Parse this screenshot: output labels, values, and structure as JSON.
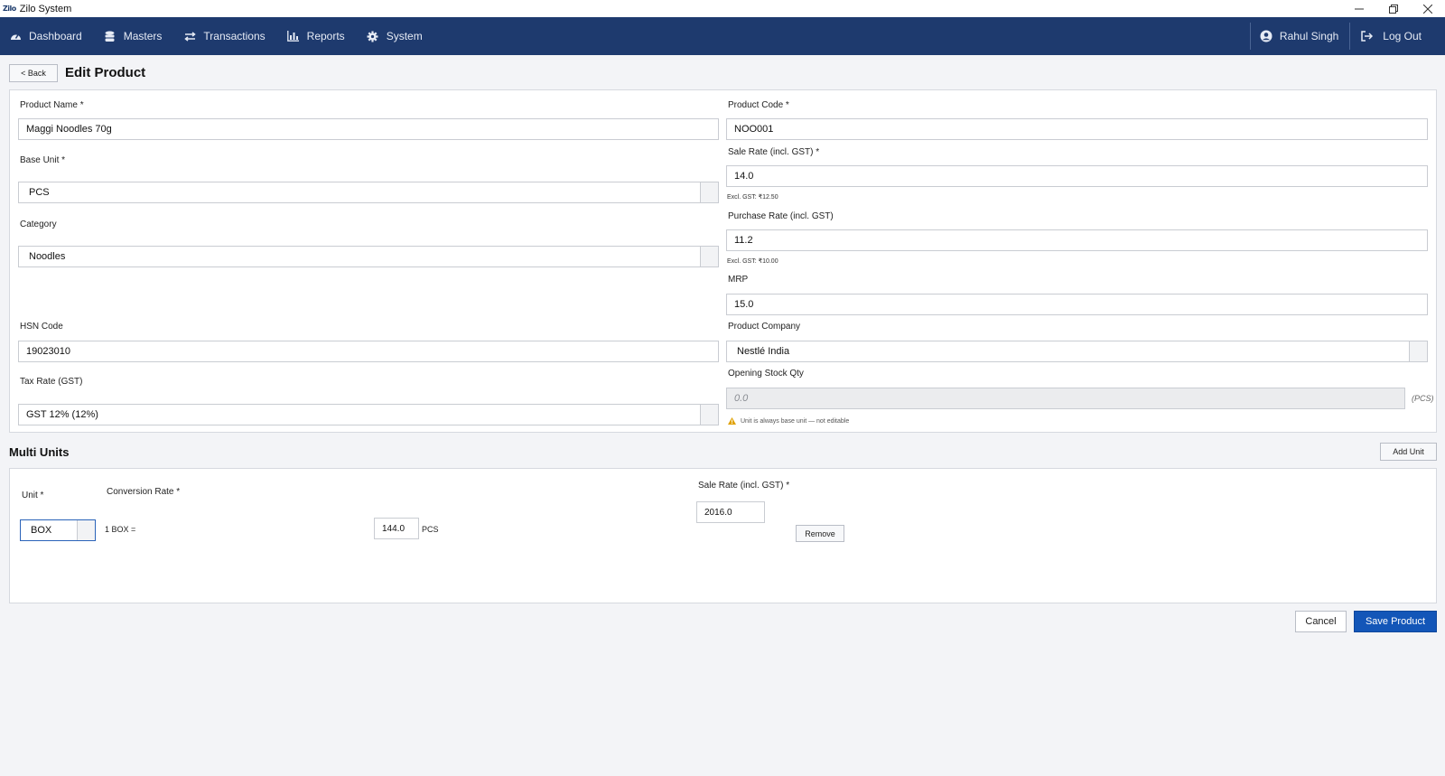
{
  "window": {
    "logo": "Zilo",
    "title": "Zilo System"
  },
  "nav": {
    "items": [
      {
        "label": "Dashboard",
        "icon": "dashboard-icon"
      },
      {
        "label": "Masters",
        "icon": "database-icon"
      },
      {
        "label": "Transactions",
        "icon": "exchange-icon"
      },
      {
        "label": "Reports",
        "icon": "chart-icon"
      },
      {
        "label": "System",
        "icon": "gear-icon"
      }
    ],
    "user": "Rahul Singh",
    "logout": "Log Out"
  },
  "header": {
    "back_label": "< Back",
    "title": "Edit Product"
  },
  "form": {
    "product_name": {
      "label": "Product Name *",
      "value": "Maggi Noodles 70g"
    },
    "product_code": {
      "label": "Product Code *",
      "value": "NOO001"
    },
    "base_unit": {
      "label": "Base Unit *",
      "value": "PCS"
    },
    "sale_rate": {
      "label": "Sale Rate (incl. GST) *",
      "value": "14.0",
      "hint": "Excl. GST: ₹12.50"
    },
    "category": {
      "label": "Category",
      "value": "Noodles"
    },
    "purchase_rate": {
      "label": "Purchase Rate (incl. GST)",
      "value": "11.2",
      "hint": "Excl. GST: ₹10.00"
    },
    "mrp": {
      "label": "MRP",
      "value": "15.0"
    },
    "hsn_code": {
      "label": "HSN Code",
      "value": "19023010"
    },
    "product_company": {
      "label": "Product Company",
      "value": "Nestlé India"
    },
    "tax_rate": {
      "label": "Tax Rate (GST)",
      "value": "GST 12% (12%)"
    },
    "opening_stock": {
      "label": "Opening Stock Qty",
      "value": "0.0",
      "unit": "(PCS)",
      "hint": "Unit is always base unit — not editable"
    }
  },
  "multi_units": {
    "title": "Multi Units",
    "add_label": "Add Unit",
    "unit_label": "Unit *",
    "conversion_label": "Conversion Rate *",
    "sale_rate_label": "Sale Rate (incl. GST) *",
    "rows": [
      {
        "unit": "BOX",
        "prefix": "1 BOX =",
        "conversion": "144.0",
        "base_unit": "PCS",
        "sale_rate": "2016.0",
        "remove_label": "Remove"
      }
    ]
  },
  "footer": {
    "cancel_label": "Cancel",
    "save_label": "Save Product"
  },
  "colors": {
    "navbar": "#1e3a6e",
    "primary_button": "#1356b8",
    "warning": "#e0a100"
  }
}
